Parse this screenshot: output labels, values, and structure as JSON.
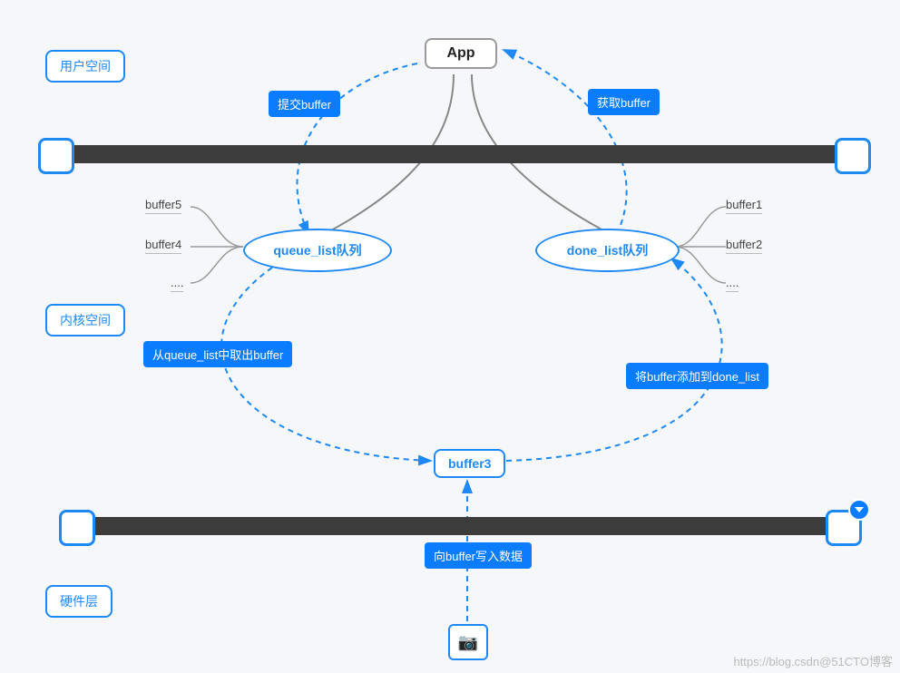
{
  "layers": {
    "user_space": "用户空间",
    "kernel_space": "内核空间",
    "hardware": "硬件层"
  },
  "nodes": {
    "app": "App",
    "queue_list": "queue_list队列",
    "done_list": "done_list队列",
    "buffer3": "buffer3"
  },
  "edge_labels": {
    "submit_buffer": "提交buffer",
    "fetch_buffer": "获取buffer",
    "take_from_queue": "从queue_list中取出buffer",
    "add_to_done": "将buffer添加到done_list",
    "write_buffer": "向buffer写入数据"
  },
  "queue_leaves": {
    "b5": "buffer5",
    "b4": "buffer4",
    "qdots": "...."
  },
  "done_leaves": {
    "b1": "buffer1",
    "b2": "buffer2",
    "ddots": "...."
  },
  "camera_icon": "📷",
  "watermark": "https://blog.csdn@51CTO博客"
}
